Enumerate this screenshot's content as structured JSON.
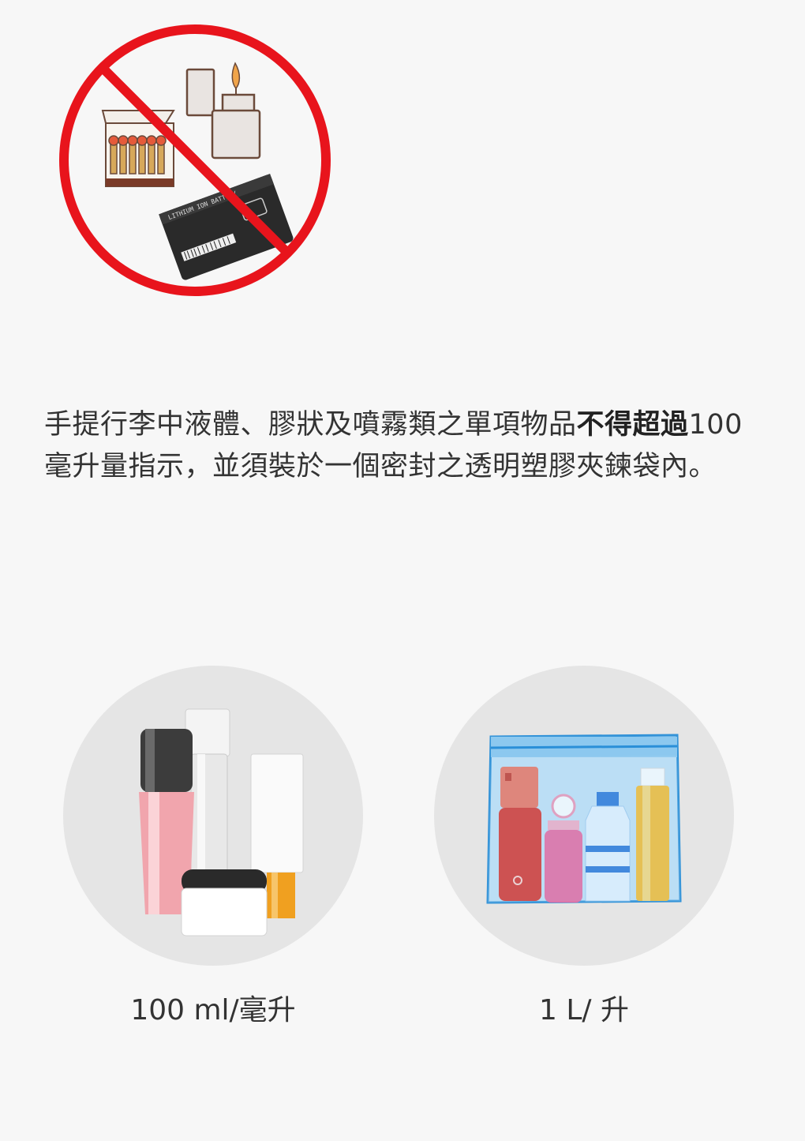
{
  "rule": {
    "text_normal": "手提行李中液體、膠狀及噴霧類之單項物品",
    "text_bold": "不得超過",
    "text_after": "100毫升量指示，並須裝於一個密封之透明塑膠夾鍊袋內。"
  },
  "battery": {
    "label": "LITHIUM ION BATTERY"
  },
  "items": [
    {
      "caption": "100 ml/毫升",
      "icon": "cosmetics-icon"
    },
    {
      "caption": "1 L/ 升",
      "icon": "ziplock-bag-icon"
    }
  ],
  "colors": {
    "prohibit_red": "#e8141c",
    "bag_blue": "#2a8fd8"
  }
}
